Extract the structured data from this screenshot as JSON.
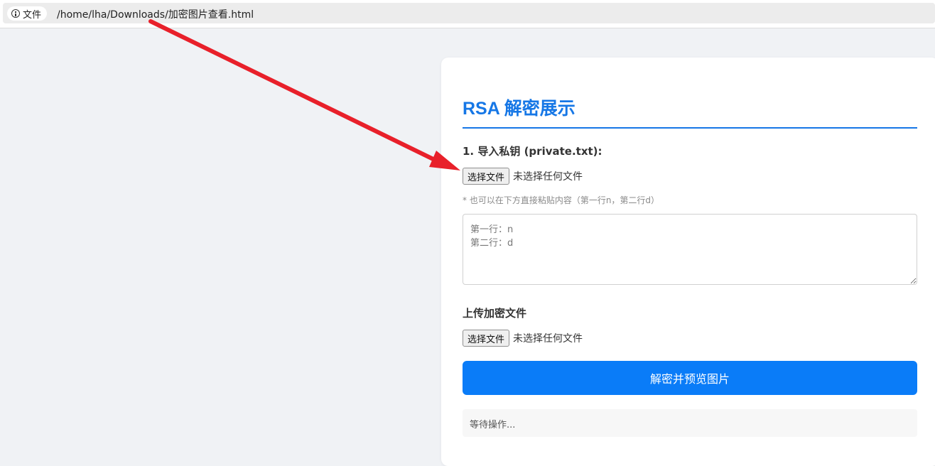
{
  "browser": {
    "site_label": "文件",
    "url": "/home/lha/Downloads/加密图片查看.html"
  },
  "page": {
    "title": "RSA 解密展示",
    "step1_label": "1. 导入私钥 (private.txt):",
    "file_button_label": "选择文件",
    "no_file_text": "未选择任何文件",
    "hint": "* 也可以在下方直接粘贴内容（第一行n，第二行d）",
    "key_placeholder": "第一行：n\n第二行：d",
    "step2_label": "上传加密文件",
    "file_button_label_2": "选择文件",
    "no_file_text_2": "未选择任何文件",
    "decrypt_button_label": "解密并预览图片",
    "status_text": "等待操作..."
  },
  "annotation": {
    "color": "#e8202a",
    "icon": "arrow-icon"
  }
}
